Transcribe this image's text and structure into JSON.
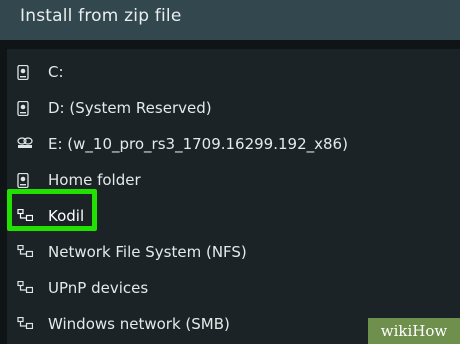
{
  "dialog": {
    "title": "Install from zip file"
  },
  "items": [
    {
      "label": "C:",
      "icon": "hard-drive-icon"
    },
    {
      "label": "D: (System Reserved)",
      "icon": "hard-drive-icon"
    },
    {
      "label": "E: (w_10_pro_rs3_1709.16299.192_x86)",
      "icon": "optical-drive-icon"
    },
    {
      "label": "Home folder",
      "icon": "hard-drive-icon"
    },
    {
      "label": "Kodil",
      "icon": "network-icon",
      "selected": true
    },
    {
      "label": "Network File System (NFS)",
      "icon": "network-icon"
    },
    {
      "label": "UPnP devices",
      "icon": "network-icon"
    },
    {
      "label": "Windows network (SMB)",
      "icon": "network-icon"
    }
  ],
  "watermark": "wikiHow",
  "colors": {
    "header": "#33474f",
    "panel": "#1c2326",
    "highlight": "#22e000",
    "watermark": "#6f8f4c"
  }
}
